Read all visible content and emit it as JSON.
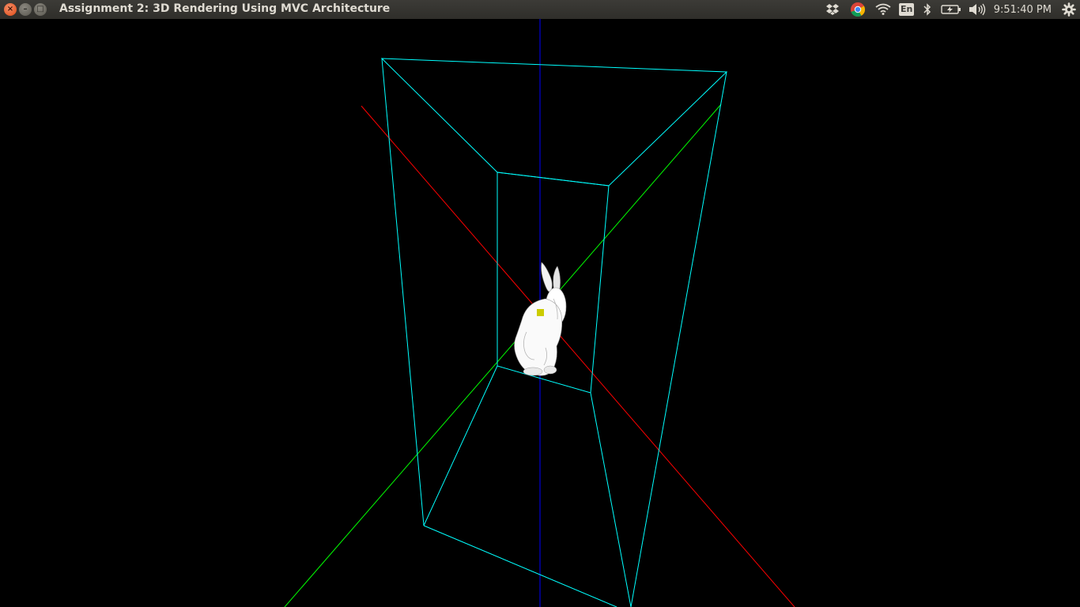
{
  "window": {
    "title": "Assignment 2: 3D Rendering Using MVC Architecture",
    "close_glyph": "×",
    "minimize_glyph": "–",
    "maximize_glyph": "□"
  },
  "tray": {
    "icons": [
      "dropbox-icon",
      "chrome-icon",
      "wifi-icon",
      "keyboard-layout-icon",
      "bluetooth-icon",
      "battery-icon",
      "volume-icon",
      "settings-gear-icon"
    ],
    "keyboard_layout": "En",
    "time": "9:51:40 PM"
  },
  "scene": {
    "background_color": "#000000",
    "frustum_color": "#00ffff",
    "x_axis_color": "#ff0000",
    "y_axis_color": "#00ff00",
    "z_axis_color": "#0000ff",
    "light_marker_color": "#cccc00",
    "model": "bunny"
  }
}
